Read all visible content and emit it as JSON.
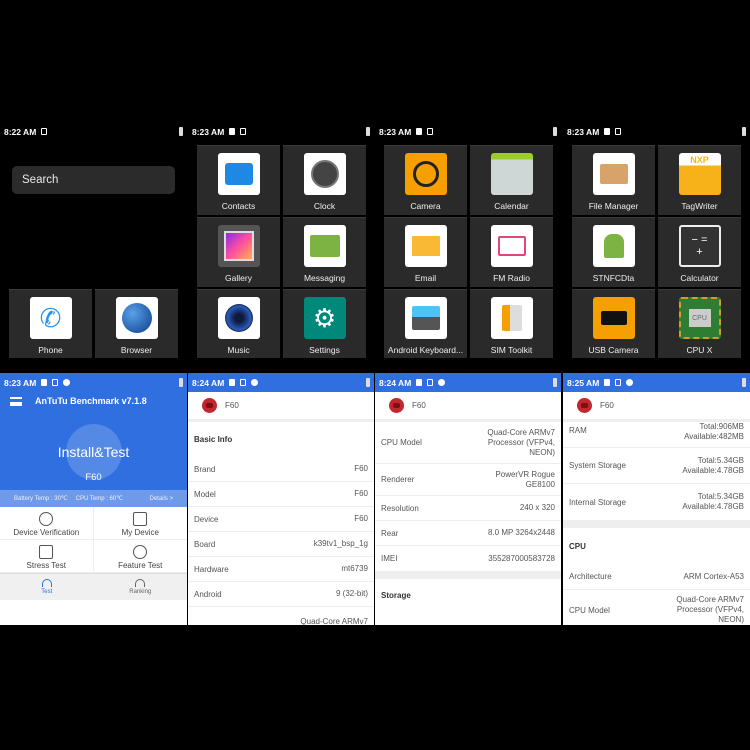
{
  "home": {
    "status_time": "8:22 AM",
    "search_placeholder": "Search",
    "dock": [
      {
        "label": "Phone",
        "icon": "phone-icon"
      },
      {
        "label": "Browser",
        "icon": "globe-icon"
      }
    ]
  },
  "drawer_pages": [
    {
      "status_time": "8:23 AM",
      "apps": [
        {
          "label": "Contacts",
          "icon": "contacts-icon"
        },
        {
          "label": "Clock",
          "icon": "clock-icon"
        },
        {
          "label": "Gallery",
          "icon": "gallery-icon"
        },
        {
          "label": "Messaging",
          "icon": "messaging-icon"
        },
        {
          "label": "Music",
          "icon": "music-icon"
        },
        {
          "label": "Settings",
          "icon": "settings-icon"
        }
      ]
    },
    {
      "status_time": "8:23 AM",
      "apps": [
        {
          "label": "Camera",
          "icon": "camera-icon"
        },
        {
          "label": "Calendar",
          "icon": "calendar-icon"
        },
        {
          "label": "Email",
          "icon": "email-icon"
        },
        {
          "label": "FM Radio",
          "icon": "radio-icon"
        },
        {
          "label": "Android Keyboard...",
          "icon": "keyboard-icon"
        },
        {
          "label": "SIM Toolkit",
          "icon": "sim-icon"
        }
      ]
    },
    {
      "status_time": "8:23 AM",
      "apps": [
        {
          "label": "File Manager",
          "icon": "file-manager-icon"
        },
        {
          "label": "TagWriter",
          "icon": "nfc-tag-icon"
        },
        {
          "label": "STNFCDta",
          "icon": "android-st-icon"
        },
        {
          "label": "Calculator",
          "icon": "calculator-icon"
        },
        {
          "label": "USB Camera",
          "icon": "usb-camera-icon"
        },
        {
          "label": "CPU X",
          "icon": "cpu-icon"
        }
      ]
    }
  ],
  "antutu_main": {
    "status_time": "8:23 AM",
    "title": "AnTuTu Benchmark v7.1.8",
    "install_label": "Install&Test",
    "model": "F60",
    "battery_temp": "Battery Temp : 30℃",
    "cpu_temp": "CPU Temp : 60℃",
    "details": "Details >",
    "features": [
      "Device Verification",
      "My Device",
      "Stress Test",
      "Feature Test"
    ],
    "tabs": [
      "Test",
      "Ranking"
    ]
  },
  "info1": {
    "status_time": "8:24 AM",
    "device": "F60",
    "section": "Basic Info",
    "rows": [
      {
        "k": "Brand",
        "v": "F60"
      },
      {
        "k": "Model",
        "v": "F60"
      },
      {
        "k": "Device",
        "v": "F60"
      },
      {
        "k": "Board",
        "v": "k39tv1_bsp_1g"
      },
      {
        "k": "Hardware",
        "v": "mt6739"
      },
      {
        "k": "Android",
        "v": "9 (32-bit)"
      },
      {
        "k": "",
        "v": "Quad-Core ARMv7"
      }
    ]
  },
  "info2": {
    "status_time": "8:24 AM",
    "device": "F60",
    "rows": [
      {
        "k": "CPU Model",
        "v1": "Quad-Core ARMv7",
        "v2": "Processor (VFPv4,",
        "v3": "NEON)"
      },
      {
        "k": "Renderer",
        "v1": "PowerVR Rogue",
        "v2": "GE8100"
      },
      {
        "k": "Resolution",
        "v1": "240 x 320"
      },
      {
        "k": "Rear",
        "v1": "8.0 MP 3264x2448"
      },
      {
        "k": "IMEI",
        "v1": "355287000583728"
      }
    ],
    "section": "Storage"
  },
  "info3": {
    "status_time": "8:25 AM",
    "device": "F60",
    "rows": [
      {
        "k": "RAM",
        "v1": "Total:906MB",
        "v2": "Available:482MB"
      },
      {
        "k": "System Storage",
        "v1": "Total:5.34GB",
        "v2": "Available:4.78GB"
      },
      {
        "k": "Internal Storage",
        "v1": "Total:5.34GB",
        "v2": "Available:4.78GB"
      }
    ],
    "section": "CPU",
    "cpu_rows": [
      {
        "k": "Architecture",
        "v1": "ARM Cortex-A53"
      },
      {
        "k": "CPU Model",
        "v1": "Quad-Core ARMv7",
        "v2": "Processor (VFPv4,",
        "v3": "NEON)"
      }
    ]
  },
  "colors": {
    "antutu_blue": "#2f6fe0",
    "tile_bg": "#2a2a2a"
  }
}
